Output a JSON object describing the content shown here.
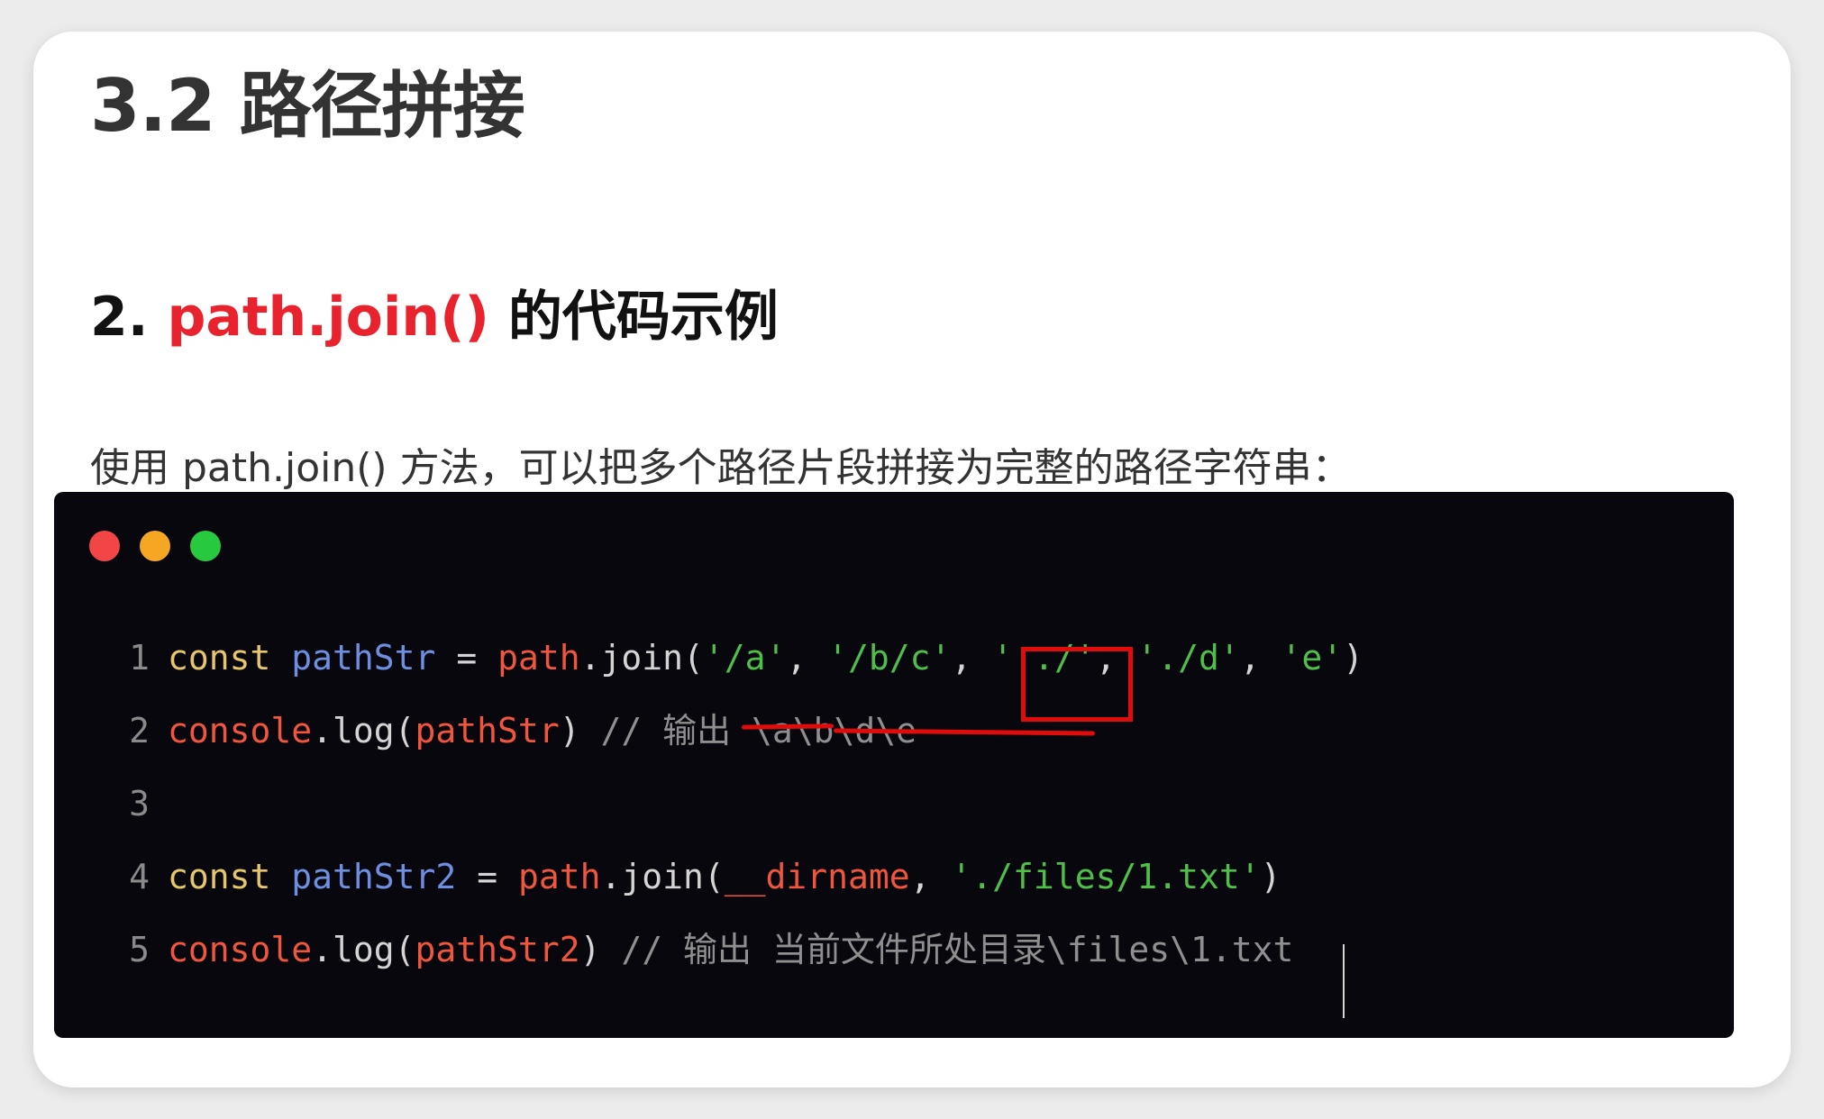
{
  "heading": "3.2 路径拼接",
  "subheading": {
    "number": "2.",
    "code": "path.join()",
    "text": "的代码示例"
  },
  "paragraph": "使用 path.join() 方法，可以把多个路径片段拼接为完整的路径字符串：",
  "code_window": {
    "dots": [
      {
        "name": "close",
        "color": "#f24646"
      },
      {
        "name": "minimize",
        "color": "#f5a623"
      },
      {
        "name": "maximize",
        "color": "#27c93f"
      }
    ],
    "lines": [
      {
        "number": "1",
        "tokens": [
          {
            "type": "kw",
            "text": "const"
          },
          {
            "type": "punc",
            "text": " "
          },
          {
            "type": "var",
            "text": "pathStr"
          },
          {
            "type": "punc",
            "text": " = "
          },
          {
            "type": "obj",
            "text": "path"
          },
          {
            "type": "punc",
            "text": ".join("
          },
          {
            "type": "str",
            "text": "'/a'"
          },
          {
            "type": "punc",
            "text": ", "
          },
          {
            "type": "str",
            "text": "'/b/c'"
          },
          {
            "type": "punc",
            "text": ", "
          },
          {
            "type": "str",
            "text": "'../'"
          },
          {
            "type": "punc",
            "text": ", "
          },
          {
            "type": "str",
            "text": "'./d'"
          },
          {
            "type": "punc",
            "text": ", "
          },
          {
            "type": "str",
            "text": "'e'"
          },
          {
            "type": "punc",
            "text": ")"
          }
        ]
      },
      {
        "number": "2",
        "tokens": [
          {
            "type": "obj",
            "text": "console"
          },
          {
            "type": "punc",
            "text": ".log("
          },
          {
            "type": "obj",
            "text": "pathStr"
          },
          {
            "type": "punc",
            "text": ") "
          },
          {
            "type": "cmt",
            "text": "// 输出 \\a\\b\\d\\e"
          }
        ]
      },
      {
        "number": "3",
        "tokens": []
      },
      {
        "number": "4",
        "tokens": [
          {
            "type": "kw",
            "text": "const"
          },
          {
            "type": "punc",
            "text": " "
          },
          {
            "type": "var",
            "text": "pathStr2"
          },
          {
            "type": "punc",
            "text": " = "
          },
          {
            "type": "obj",
            "text": "path"
          },
          {
            "type": "punc",
            "text": ".join("
          },
          {
            "type": "obj",
            "text": "__dirname"
          },
          {
            "type": "punc",
            "text": ", "
          },
          {
            "type": "str",
            "text": "'./files/1.txt'"
          },
          {
            "type": "punc",
            "text": ")"
          }
        ]
      },
      {
        "number": "5",
        "tokens": [
          {
            "type": "obj",
            "text": "console"
          },
          {
            "type": "punc",
            "text": ".log("
          },
          {
            "type": "obj",
            "text": "pathStr2"
          },
          {
            "type": "punc",
            "text": ") "
          },
          {
            "type": "cmt",
            "text": "// 输出 当前文件所处目录\\files\\1.txt"
          }
        ]
      }
    ]
  },
  "annotation_color": "#e00b0b"
}
